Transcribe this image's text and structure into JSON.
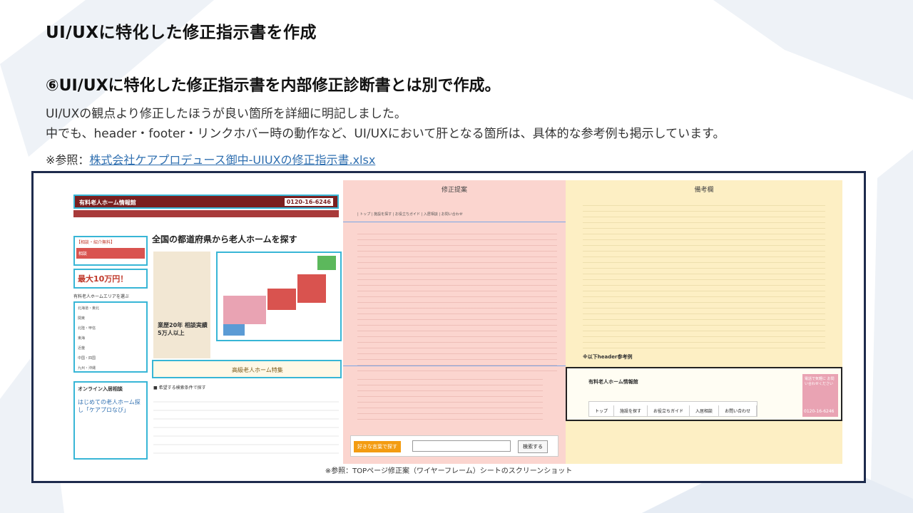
{
  "slide": {
    "title": "UI/UXに特化した修正指示書を作成",
    "subtitle": "⑥UI/UXに特化した修正指示書を内部修正診断書とは別で作成。",
    "body_line1": "UI/UXの観点より修正したほうが良い箇所を詳細に明記しました。",
    "body_line2": "中でも、header・footer・リンクホバー時の動作など、UI/UXにおいて肝となる箇所は、具体的な参考例も掲示しています。",
    "ref_prefix": "※参照：",
    "ref_link": "株式会社ケアプロデュース御中-UIUXの修正指示書.xlsx",
    "caption": "※参照：TOPページ修正案（ワイヤーフレーム）シートのスクリーンショット"
  },
  "sheet": {
    "pink_header": "修正提案",
    "yellow_header": "備考欄",
    "site_logo": "有料老人ホーム情報館",
    "site_phone": "0120-16-6246",
    "site_hero": "全国の都道府県から老人ホームを探す",
    "site_badge1": "【相談・紹介無料】",
    "site_badge2": "最大10万円！",
    "site_area_title": "有料老人ホームエリアを選ぶ",
    "site_areas": [
      "北海道・東北",
      "関東",
      "北陸・甲信",
      "東海",
      "近畿",
      "中国・四国",
      "九州・沖縄"
    ],
    "site_reception": "オンライン入居相談",
    "site_search_title": "■ 希望する検索条件で探す",
    "site_carepro": "はじめての老人ホーム探し「ケアプロなび」",
    "site_experience": "業歴20年 相談実績5万人以上",
    "site_feature": "高級老人ホーム特集",
    "yellow_note_bold": "※以下header参考例",
    "sample_logo": "有料老人ホーム情報館",
    "sample_nav": [
      "トップ",
      "施設を探す",
      "お役立ちガイド",
      "入居相談",
      "お問い合わせ"
    ],
    "sample_phone": "0120-16-6246",
    "sample_cta": "電話で気軽に お問い合わせください",
    "search_label": "好きな言葉で探す",
    "search_button": "検索する"
  },
  "colors": {
    "frame": "#1e2b4d",
    "pink": "#fbd5cf",
    "yellow": "#fdefc4",
    "link": "#2f6fb0",
    "accent_red": "#c0392b",
    "cyan": "#38b6d6"
  }
}
